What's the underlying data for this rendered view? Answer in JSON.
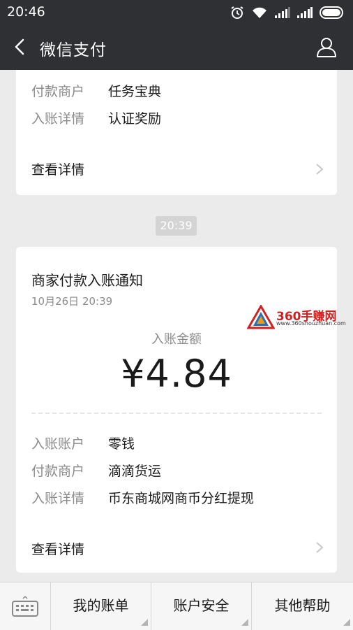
{
  "status_bar": {
    "time": "20:46"
  },
  "nav": {
    "title": "微信支付"
  },
  "card1": {
    "rows": [
      {
        "label": "付款商户",
        "value": "任务宝典"
      },
      {
        "label": "入账详情",
        "value": "认证奖励"
      }
    ],
    "link": "查看详情"
  },
  "timestamp": "20:39",
  "card2": {
    "title": "商家付款入账通知",
    "date": "10月26日  20:39",
    "amount_label": "入账金额",
    "amount": "¥4.84",
    "rows": [
      {
        "label": "入账账户",
        "value": "零钱"
      },
      {
        "label": "付款商户",
        "value": "滴滴货运"
      },
      {
        "label": "入账详情",
        "value": "币东商城网商币分红提现"
      }
    ],
    "link": "查看详情"
  },
  "watermark": {
    "text": "360手赚网",
    "url": "www.360shouzhuan.com"
  },
  "bottom_menu": [
    "我的账单",
    "账户安全",
    "其他帮助"
  ]
}
